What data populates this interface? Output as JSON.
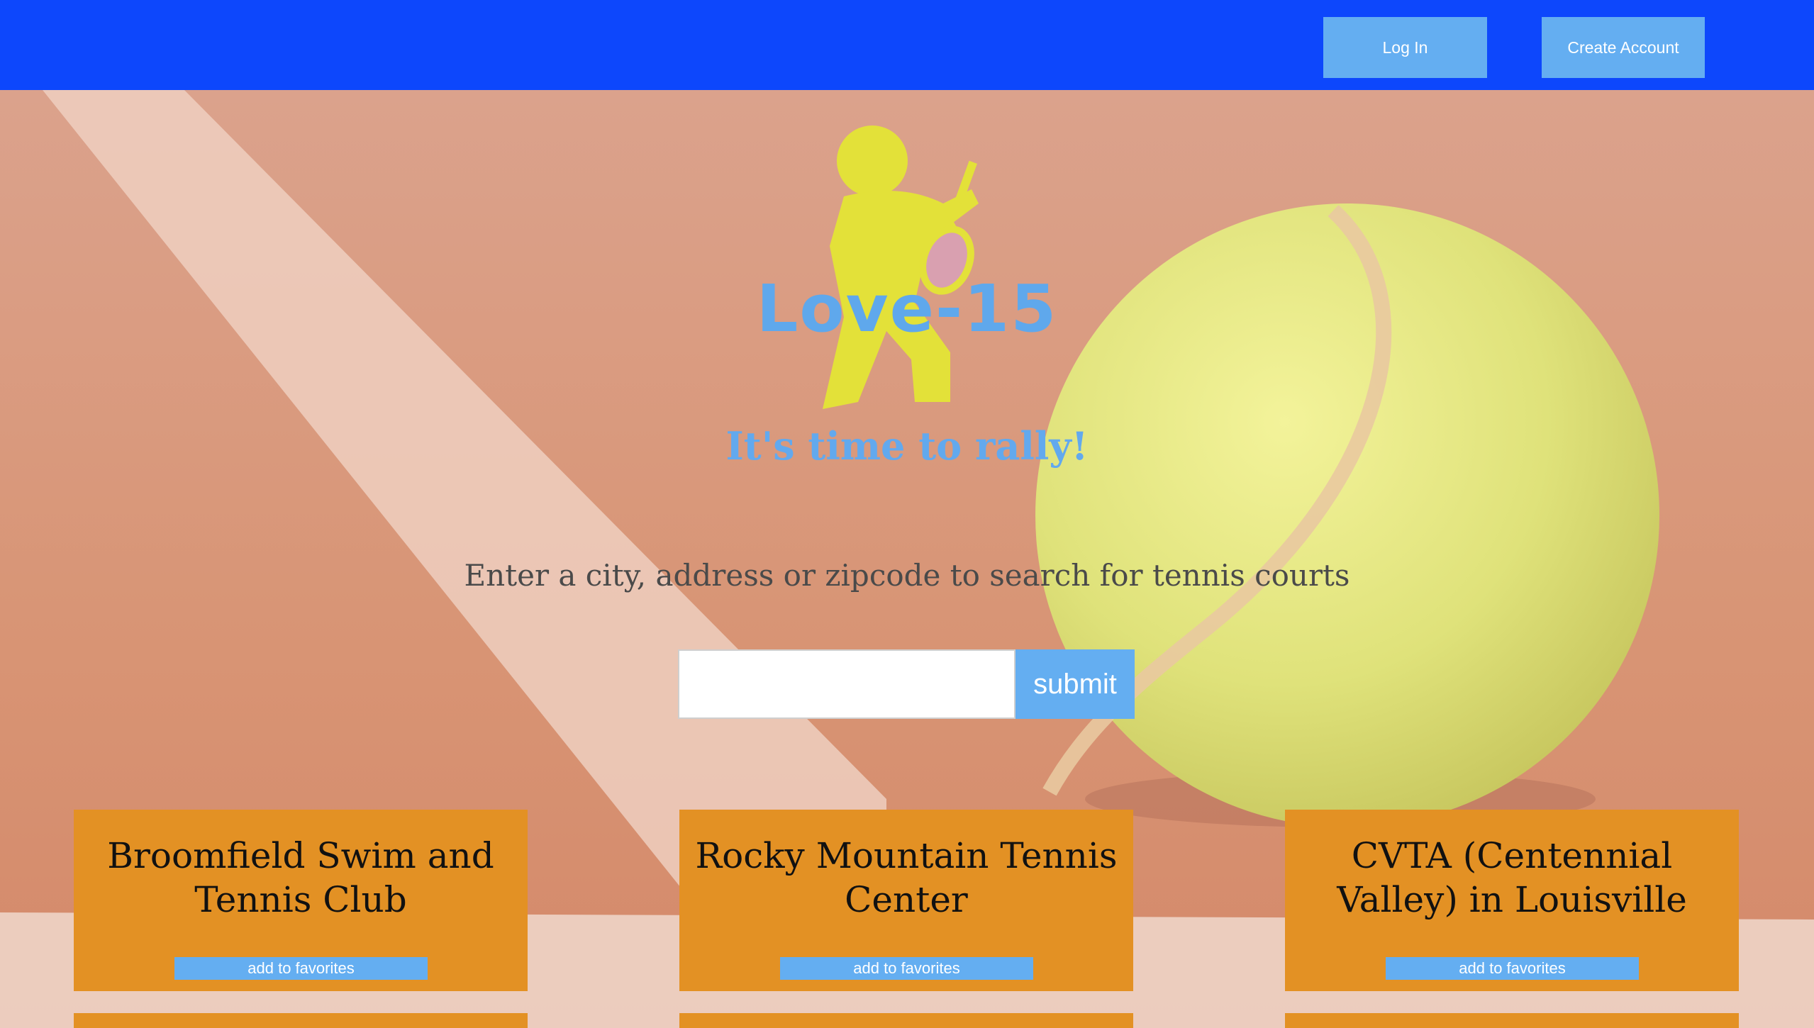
{
  "header": {
    "login_label": "Log In",
    "create_account_label": "Create Account"
  },
  "hero": {
    "brand": "Love-15",
    "tagline": "It's time to rally!",
    "prompt": "Enter a city, address or zipcode to search for tennis courts"
  },
  "search": {
    "value": "",
    "placeholder": "",
    "submit_label": "submit"
  },
  "results": [
    {
      "name": "Broomfield Swim and Tennis Club",
      "favorite_label": "add to favorites"
    },
    {
      "name": "Rocky Mountain Tennis Center",
      "favorite_label": "add to favorites"
    },
    {
      "name": "CVTA (Centennial Valley) in Louisville",
      "favorite_label": "add to favorites"
    }
  ],
  "colors": {
    "navbar": "#0d47fc",
    "button": "#64aef1",
    "card": "#e39124",
    "brand_text": "#5fa8ec",
    "logo_figure": "#e3e139"
  },
  "icons": {
    "logo": "tennis-player-icon"
  }
}
